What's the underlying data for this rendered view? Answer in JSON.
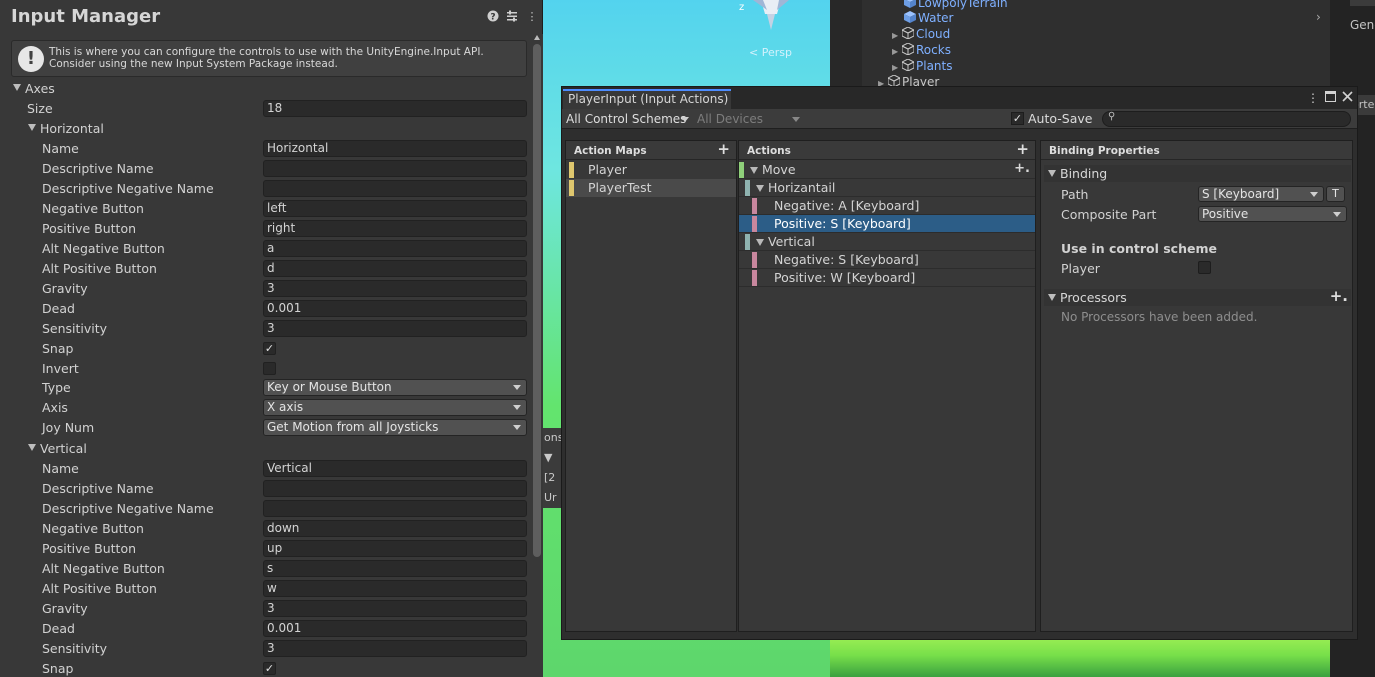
{
  "colors": {
    "action_map_bar": "#dfc76e",
    "action_bar": "#8fb3b0",
    "binding_bar": "#c8879e",
    "selection": "#2c5d87",
    "tab_accent": "#4d8cff",
    "hierarchy_link": "#7fb0ff"
  },
  "scene": {
    "gizmo_axis": "z",
    "persp_label": "< Persp",
    "console_lines": [
      "ons",
      "▼",
      "[2",
      "Ur"
    ]
  },
  "hierarchy": {
    "items": [
      {
        "label": "LowpolyTerrain",
        "icon": "cube-icon"
      },
      {
        "label": "Water",
        "icon": "cube-icon"
      },
      {
        "label": "Cloud",
        "icon": "cube-icon"
      },
      {
        "label": "Rocks",
        "icon": "cube-icon"
      },
      {
        "label": "Plants",
        "icon": "cube-icon"
      },
      {
        "label": "Player",
        "icon": "cube-icon"
      }
    ],
    "right_label": "Gene",
    "right_button": "orte"
  },
  "input_manager": {
    "title": "Input Manager",
    "header_icons": [
      "help-icon",
      "settings-icon",
      "more-icon"
    ],
    "help_text": "This is where you can configure the controls to use with the UnityEngine.Input API. Consider using the new Input System Package instead.",
    "axes_label": "Axes",
    "size_label": "Size",
    "size_value": "18",
    "horizontal": {
      "header": "Horizontal",
      "name_label": "Name",
      "name": "Horizontal",
      "desc_label": "Descriptive Name",
      "desc": "",
      "desc_neg_label": "Descriptive Negative Name",
      "desc_neg": "",
      "neg_label": "Negative Button",
      "neg": "left",
      "pos_label": "Positive Button",
      "pos": "right",
      "alt_neg_label": "Alt Negative Button",
      "alt_neg": "a",
      "alt_pos_label": "Alt Positive Button",
      "alt_pos": "d",
      "gravity_label": "Gravity",
      "gravity": "3",
      "dead_label": "Dead",
      "dead": "0.001",
      "sensitivity_label": "Sensitivity",
      "sensitivity": "3",
      "snap_label": "Snap",
      "snap": "✓",
      "invert_label": "Invert",
      "invert": "",
      "type_label": "Type",
      "type": "Key or Mouse Button",
      "axis_label": "Axis",
      "axis": "X axis",
      "joy_label": "Joy Num",
      "joy": "Get Motion from all Joysticks"
    },
    "vertical": {
      "header": "Vertical",
      "name_label": "Name",
      "name": "Vertical",
      "desc_label": "Descriptive Name",
      "desc": "",
      "desc_neg_label": "Descriptive Negative Name",
      "desc_neg": "",
      "neg_label": "Negative Button",
      "neg": "down",
      "pos_label": "Positive Button",
      "pos": "up",
      "alt_neg_label": "Alt Negative Button",
      "alt_neg": "s",
      "alt_pos_label": "Alt Positive Button",
      "alt_pos": "w",
      "gravity_label": "Gravity",
      "gravity": "3",
      "dead_label": "Dead",
      "dead": "0.001",
      "sensitivity_label": "Sensitivity",
      "sensitivity": "3",
      "snap_label": "Snap",
      "snap": "✓"
    }
  },
  "player_input": {
    "tab_title": "PlayerInput (Input Actions)",
    "window_icons": [
      "more-icon",
      "maximize-icon",
      "close-icon"
    ],
    "control_schemes": "All Control Schemes",
    "devices": "All Devices",
    "auto_save_label": "Auto-Save",
    "auto_save_checked": "✓",
    "action_maps_header": "Action Maps",
    "action_maps": [
      "Player",
      "PlayerTest"
    ],
    "actions_header": "Actions",
    "actions": {
      "move": "Move",
      "horizontal_composite": "Horizantail",
      "h_negative": "Negative: A [Keyboard]",
      "h_positive": "Positive: S [Keyboard]",
      "vertical_composite": "Vertical",
      "v_negative": "Negative: S [Keyboard]",
      "v_positive": "Positive: W [Keyboard]"
    },
    "binding_properties_header": "Binding Properties",
    "binding_section": "Binding",
    "path_label": "Path",
    "path_value": "S [Keyboard]",
    "t_button": "T",
    "composite_part_label": "Composite Part",
    "composite_part_value": "Positive",
    "use_in_scheme_label": "Use in control scheme",
    "scheme_player_label": "Player",
    "processors_section": "Processors",
    "no_processors": "No Processors have been added."
  }
}
